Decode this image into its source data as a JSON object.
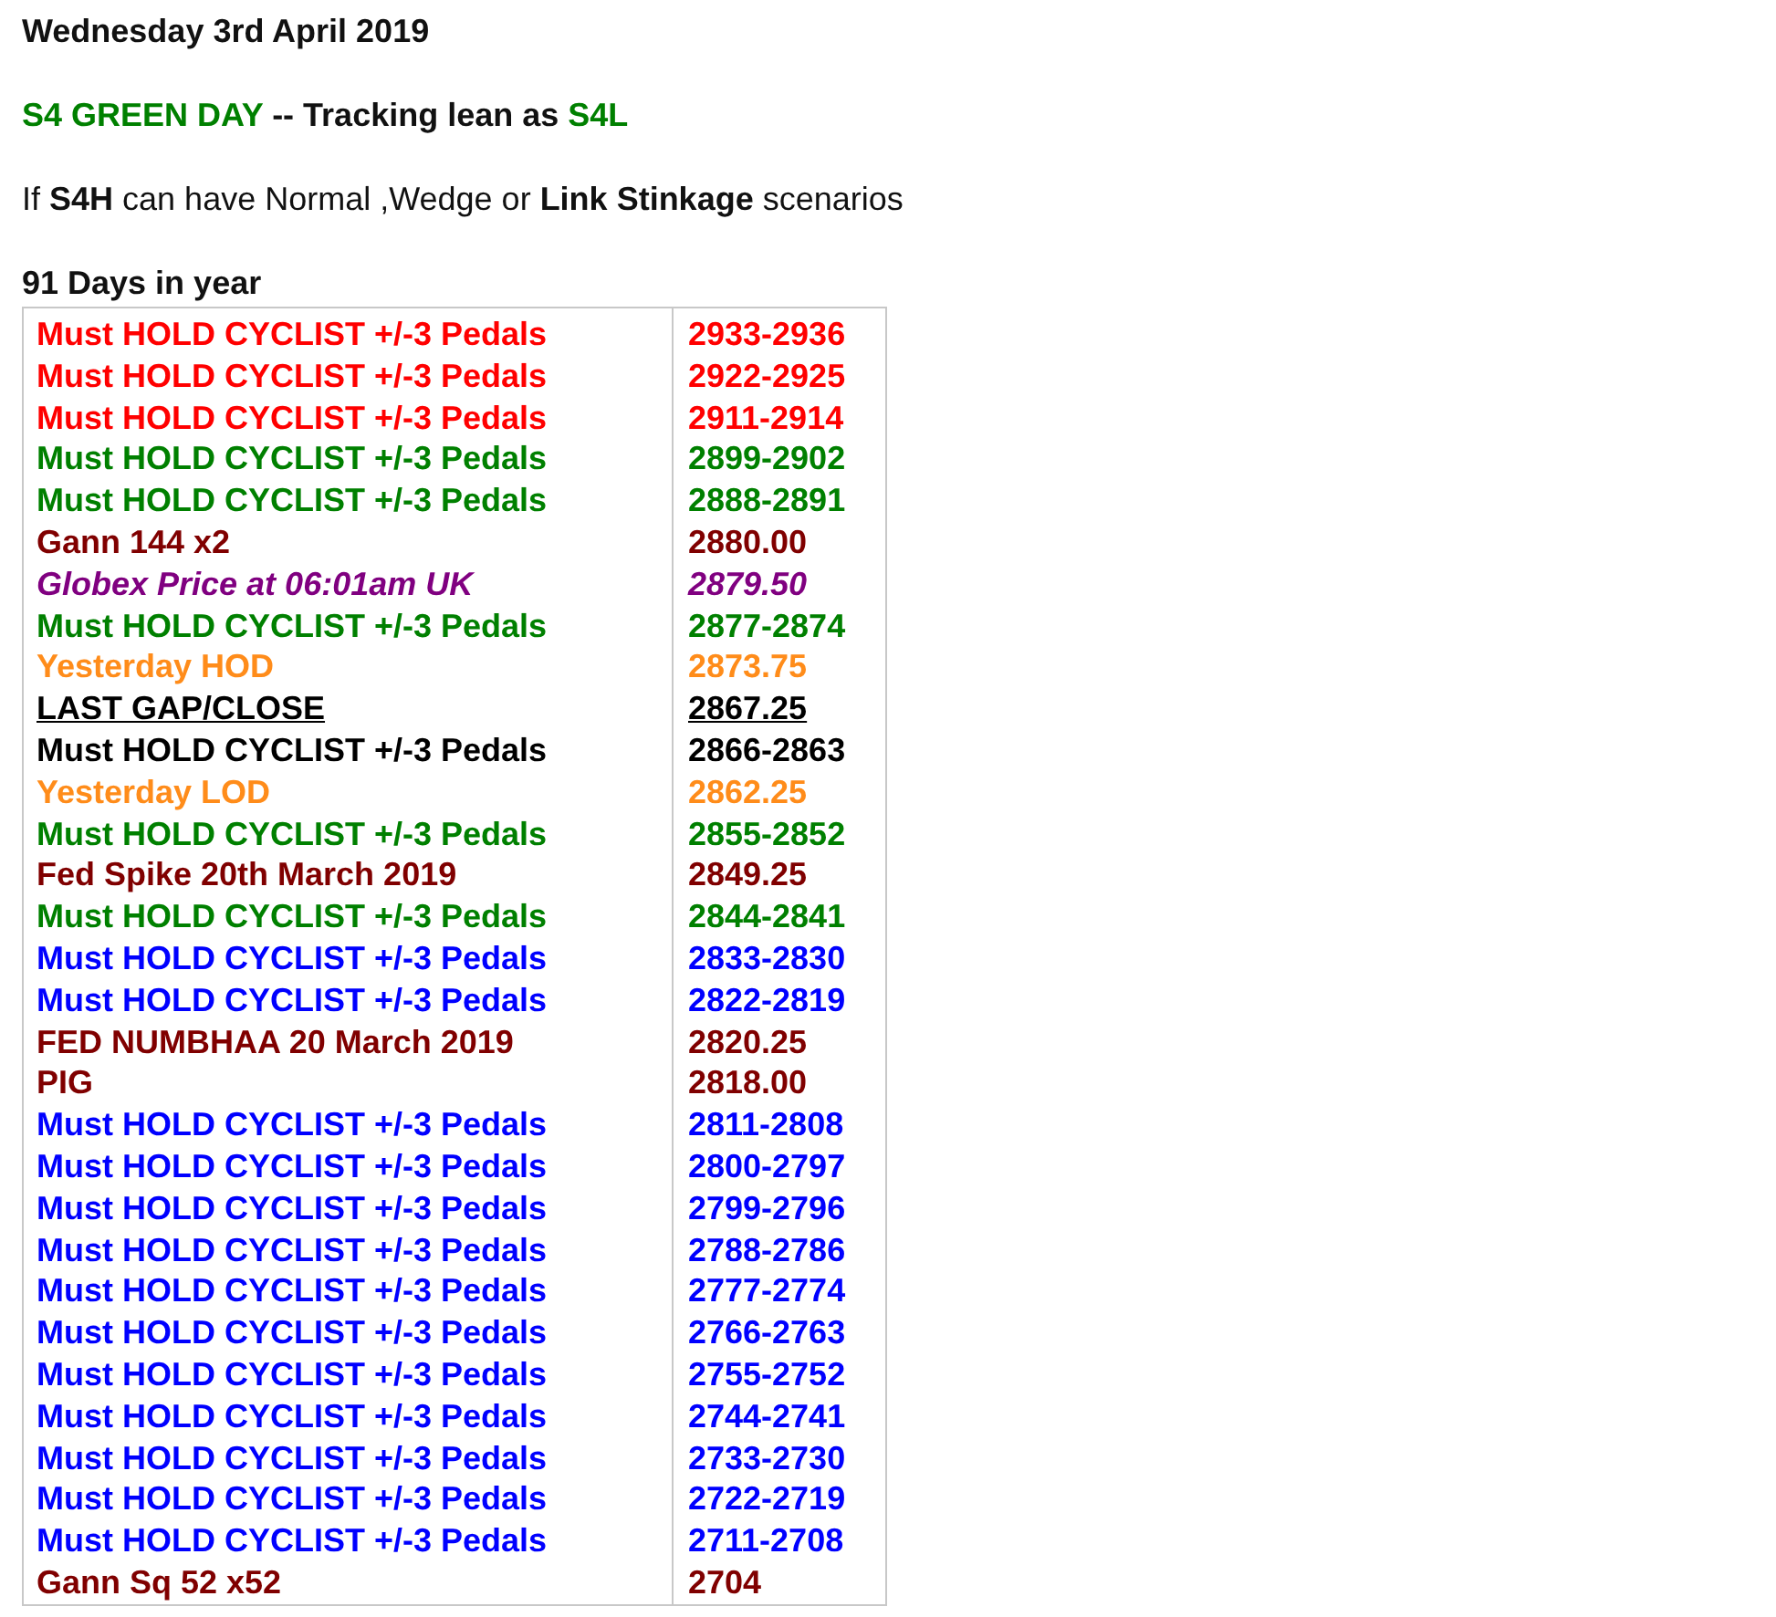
{
  "date": "Wednesday 3rd April 2019",
  "headline": [
    {
      "text": "S4 GREEN DAY",
      "color": "#008000"
    },
    {
      "text": " -- Tracking lean as ",
      "color": "#111111"
    },
    {
      "text": "S4L",
      "color": "#008000"
    }
  ],
  "note": "If **S4H** can have Normal ,Wedge or **Link Stinkage** scenarios",
  "table_title": "91 Days in year",
  "rows": [
    {
      "label": "Must HOLD CYCLIST +/-3 Pedals",
      "value": "2933-2936",
      "color": "#ff0000",
      "kind": "plain"
    },
    {
      "label": "Must HOLD CYCLIST +/-3 Pedals",
      "value": "2922-2925",
      "color": "#ff0000",
      "kind": "plain"
    },
    {
      "label": "Must HOLD CYCLIST +/-3 Pedals",
      "value": "2911-2914",
      "color": "#ff0000",
      "kind": "plain"
    },
    {
      "label": "Must HOLD CYCLIST +/-3 Pedals",
      "value": "2899-2902",
      "color": "#008000",
      "kind": "plain"
    },
    {
      "label": "Must HOLD CYCLIST +/-3 Pedals",
      "value": "2888-2891",
      "color": "#008000",
      "kind": "plain"
    },
    {
      "label": "Gann 144 x2",
      "value": "2880.00",
      "color": "#800000",
      "kind": "plain"
    },
    {
      "label": "Globex Price at 06:01am UK",
      "value": "2879.50",
      "color": "#800080",
      "kind": "italic"
    },
    {
      "label": "Must HOLD CYCLIST +/-3 Pedals",
      "value": "2877-2874",
      "color": "#008000",
      "kind": "plain"
    },
    {
      "label": "Yesterday HOD",
      "value": "2873.75",
      "color": "#ff8c1a",
      "kind": "plain"
    },
    {
      "label": "LAST GAP/CLOSE",
      "value": "2867.25",
      "color": "#000000",
      "kind": "underlined"
    },
    {
      "label": "Must HOLD CYCLIST +/-3 Pedals",
      "value": "2866-2863",
      "color": "#000000",
      "kind": "plain"
    },
    {
      "label": "Yesterday LOD",
      "value": "2862.25",
      "color": "#ff8c1a",
      "kind": "plain"
    },
    {
      "label": "Must HOLD CYCLIST +/-3 Pedals",
      "value": "2855-2852",
      "color": "#008000",
      "kind": "plain"
    },
    {
      "label": "Fed Spike 20th March 2019",
      "value": "2849.25",
      "color": "#800000",
      "kind": "plain"
    },
    {
      "label": "Must HOLD CYCLIST +/-3 Pedals",
      "value": "2844-2841",
      "color": "#008000",
      "kind": "plain"
    },
    {
      "label": "Must HOLD CYCLIST +/-3 Pedals",
      "value": "2833-2830",
      "color": "#0000ff",
      "kind": "plain"
    },
    {
      "label": "Must HOLD CYCLIST +/-3 Pedals",
      "value": "2822-2819",
      "color": "#0000ff",
      "kind": "plain"
    },
    {
      "label": "FED NUMBHAA 20 March 2019",
      "value": "2820.25",
      "color": "#800000",
      "kind": "plain"
    },
    {
      "label": "PIG",
      "value": "2818.00",
      "color": "#800000",
      "kind": "plain"
    },
    {
      "label": "Must HOLD CYCLIST +/-3 Pedals",
      "value": "2811-2808",
      "color": "#0000ff",
      "kind": "plain"
    },
    {
      "label": "Must HOLD CYCLIST +/-3 Pedals",
      "value": "2800-2797",
      "color": "#0000ff",
      "kind": "plain"
    },
    {
      "label": "Must HOLD CYCLIST +/-3 Pedals",
      "value": "2799-2796",
      "color": "#0000ff",
      "kind": "plain"
    },
    {
      "label": "Must HOLD CYCLIST +/-3 Pedals",
      "value": "2788-2786",
      "color": "#0000ff",
      "kind": "plain"
    },
    {
      "label": "Must HOLD CYCLIST +/-3 Pedals",
      "value": "2777-2774",
      "color": "#0000ff",
      "kind": "plain"
    },
    {
      "label": "Must HOLD CYCLIST +/-3 Pedals",
      "value": "2766-2763",
      "color": "#0000ff",
      "kind": "plain"
    },
    {
      "label": "Must HOLD CYCLIST +/-3 Pedals",
      "value": "2755-2752",
      "color": "#0000ff",
      "kind": "plain"
    },
    {
      "label": "Must HOLD CYCLIST +/-3 Pedals",
      "value": "2744-2741",
      "color": "#0000ff",
      "kind": "plain"
    },
    {
      "label": "Must HOLD CYCLIST +/-3 Pedals",
      "value": "2733-2730",
      "color": "#0000ff",
      "kind": "plain"
    },
    {
      "label": "Must HOLD CYCLIST +/-3 Pedals",
      "value": "2722-2719",
      "color": "#0000ff",
      "kind": "plain"
    },
    {
      "label": "Must HOLD CYCLIST +/-3 Pedals",
      "value": "2711-2708",
      "color": "#0000ff",
      "kind": "plain"
    },
    {
      "label": "Gann Sq 52 x52",
      "value": "2704",
      "color": "#800000",
      "kind": "plain"
    }
  ]
}
